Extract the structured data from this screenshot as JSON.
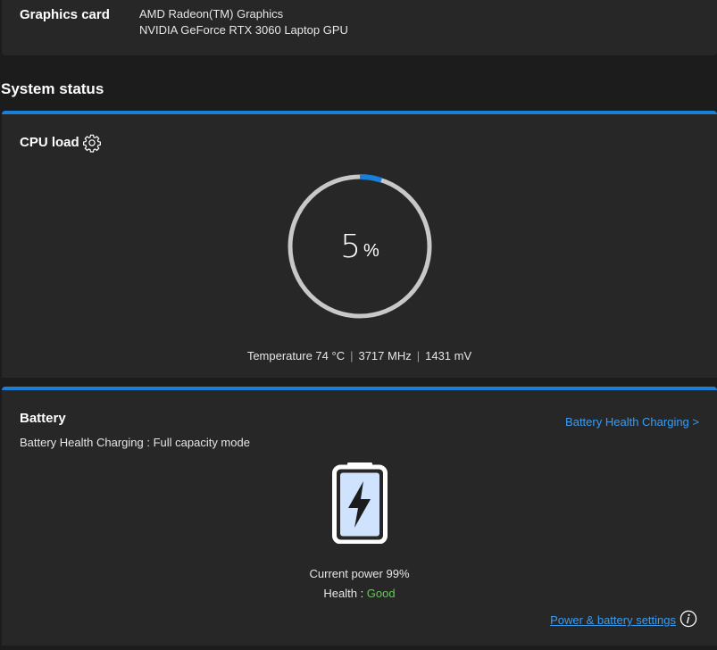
{
  "graphics": {
    "label": "Graphics card",
    "cards": [
      "AMD Radeon(TM) Graphics",
      "NVIDIA GeForce RTX 3060 Laptop GPU"
    ]
  },
  "system_status": {
    "title": "System status"
  },
  "cpu": {
    "title": "CPU load",
    "load_value": "5",
    "load_unit": "%",
    "load_percent": 5,
    "temperature": "Temperature 74 °C",
    "frequency": "3717 MHz",
    "voltage": "1431 mV",
    "icons": {
      "settings": "gear-icon"
    }
  },
  "battery": {
    "title": "Battery",
    "subtitle": "Battery Health Charging : Full capacity mode",
    "link": "Battery Health Charging >",
    "power": "Current power 99%",
    "health_label": "Health : ",
    "health_value": "Good",
    "settings_link": "Power & battery settings",
    "icons": {
      "battery": "battery-charging-icon",
      "info": "info-icon"
    }
  },
  "colors": {
    "accent": "#1a7fd8",
    "link": "#3b9cf0",
    "good": "#6cc25f",
    "gauge_track": "#c8c8c8",
    "background": "#1c1c1c",
    "card": "#272727"
  }
}
